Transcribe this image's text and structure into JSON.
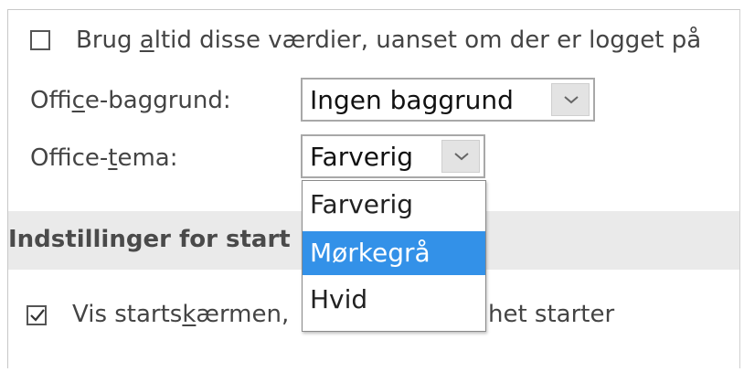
{
  "options": {
    "always_use_values": {
      "label_pre": "Brug ",
      "label_key": "a",
      "label_post": "ltid disse værdier, uanset om der er logget på",
      "checked": false
    },
    "background": {
      "label_pre": "Offi",
      "label_key": "c",
      "label_post": "e-baggrund:",
      "value": "Ingen baggrund"
    },
    "theme": {
      "label_pre": "Office-",
      "label_key": "t",
      "label_post": "ema:",
      "value": "Farverig",
      "dropdown_options": [
        "Farverig",
        "Mørkegrå",
        "Hvid"
      ],
      "highlighted_option": "Mørkegrå"
    }
  },
  "startup": {
    "section_title": "Indstillinger for start",
    "show_start_screen": {
      "label_pre": "Vis starts",
      "label_key": "k",
      "label_post": "ærmen, ",
      "label_tail": "het starter",
      "checked": true
    }
  },
  "colors": {
    "highlight": "#3391e8",
    "section_bg": "#eaeaea"
  }
}
